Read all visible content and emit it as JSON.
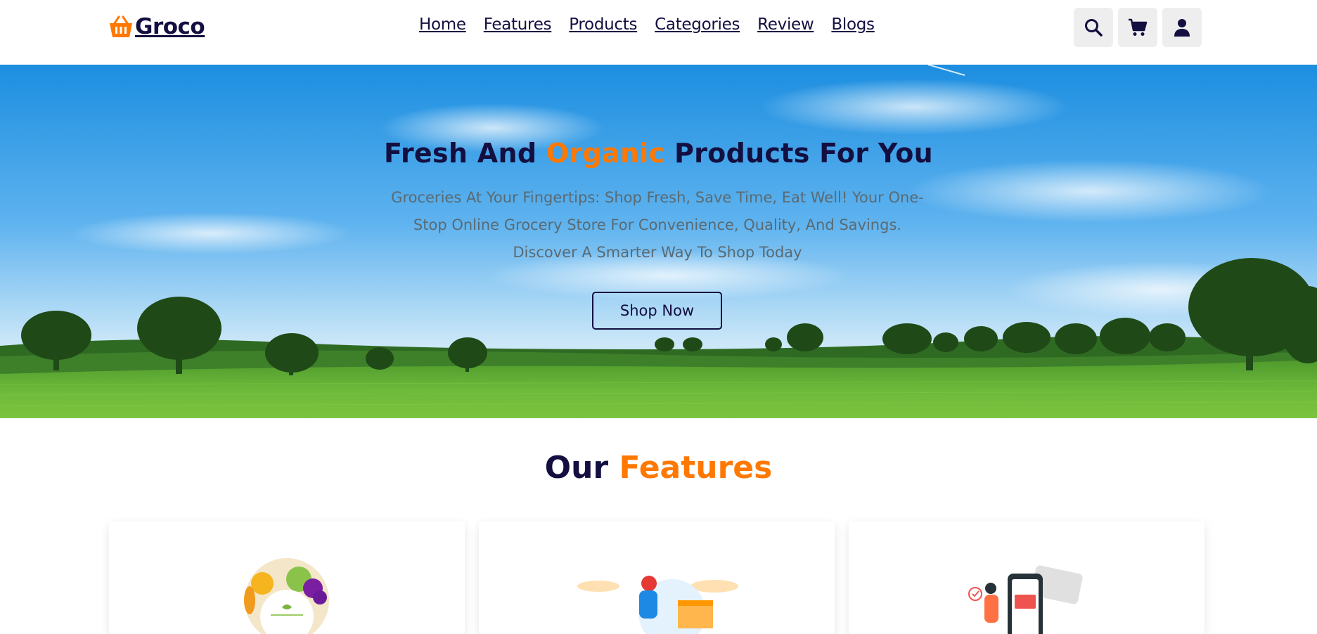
{
  "brand": {
    "name": "Groco",
    "logo_icon": "basket-icon",
    "accent_color": "#ff7800",
    "primary_color": "#130f40"
  },
  "nav": {
    "items": [
      {
        "label": "Home"
      },
      {
        "label": "Features"
      },
      {
        "label": "Products"
      },
      {
        "label": "Categories"
      },
      {
        "label": "Review"
      },
      {
        "label": "Blogs"
      }
    ]
  },
  "header_icons": [
    "search-icon",
    "cart-icon",
    "user-icon"
  ],
  "hero": {
    "title_part1": "Fresh And ",
    "title_accent": "Organic",
    "title_part2": " Products For You",
    "text": "Groceries At Your Fingertips: Shop Fresh, Save Time, Eat Well! Your One-Stop Online Grocery Store For Convenience, Quality, And Savings. Discover A Smarter Way To Shop Today",
    "button_label": "Shop Now"
  },
  "features": {
    "title_part1": "Our ",
    "title_accent": "Features",
    "cards": [
      {
        "image": "organic-food-illustration"
      },
      {
        "image": "delivery-illustration"
      },
      {
        "image": "mobile-payment-illustration"
      }
    ]
  }
}
